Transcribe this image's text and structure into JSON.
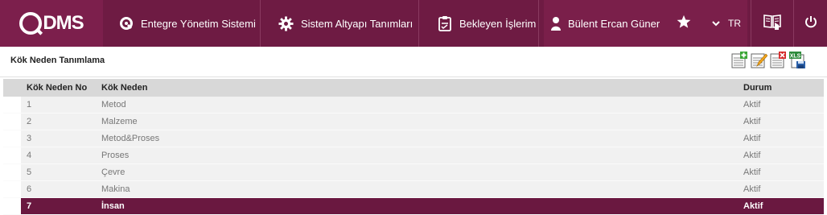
{
  "header": {
    "logo_text": "DMS",
    "nav": [
      {
        "label": "Entegre Yönetim Sistemi",
        "icon": "q-logo-icon"
      },
      {
        "label": "Sistem Altyapı Tanımları",
        "icon": "gear-icon"
      },
      {
        "label": "Bekleyen İşlerim",
        "icon": "clipboard-icon"
      }
    ],
    "user_name": "Bülent Ercan Güner",
    "language": "TR"
  },
  "page": {
    "title": "Kök Neden Tanımlama"
  },
  "grid": {
    "columns": [
      "Kök Neden No",
      "Kök Neden",
      "Durum"
    ],
    "rows": [
      {
        "no": "1",
        "name": "Metod",
        "status": "Aktif"
      },
      {
        "no": "2",
        "name": "Malzeme",
        "status": "Aktif"
      },
      {
        "no": "3",
        "name": "Metod&Proses",
        "status": "Aktif"
      },
      {
        "no": "4",
        "name": "Proses",
        "status": "Aktif"
      },
      {
        "no": "5",
        "name": "Çevre",
        "status": "Aktif"
      },
      {
        "no": "6",
        "name": "Makina",
        "status": "Aktif"
      },
      {
        "no": "7",
        "name": "İnsan",
        "status": "Aktif"
      }
    ],
    "selected_row_index": 6
  },
  "toolbar": {
    "icons": [
      "add-record-icon",
      "edit-record-icon",
      "delete-record-icon",
      "export-excel-icon"
    ],
    "excel_label": "XLS"
  },
  "colors": {
    "brand": "#6e1b43",
    "brand_dark": "#6a1840",
    "header_gray": "#d8d8d8",
    "row_bg": "#f1f1f1"
  }
}
